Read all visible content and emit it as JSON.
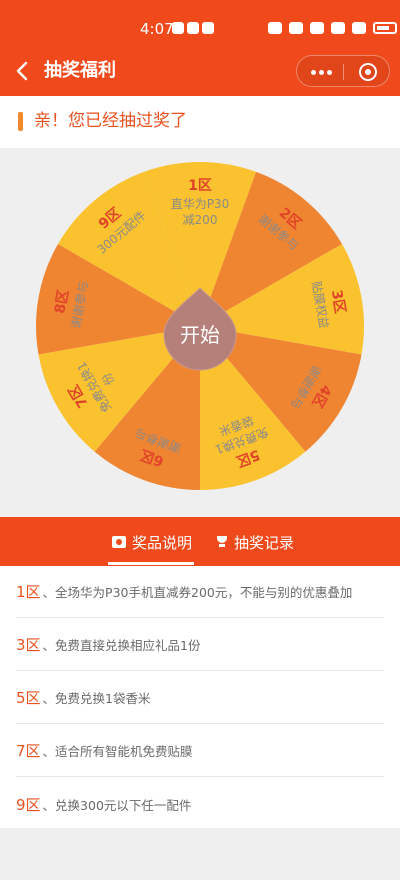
{
  "status_bar": {
    "time": "4:07"
  },
  "nav": {
    "title": "抽奖福利"
  },
  "notice": {
    "text": "亲！您已经抽过奖了"
  },
  "wheel": {
    "start_label": "开始",
    "colors": {
      "yellow": "#f9c22e",
      "orange": "#ef8431",
      "hub": "#b57f7a",
      "zone_text": "#e2442a",
      "prize_text": "#8a8a8a"
    },
    "segments": [
      {
        "zone": "1区",
        "lines": [
          "直华为P30",
          "减200"
        ],
        "color": "yellow"
      },
      {
        "zone": "2区",
        "lines": [
          "谢谢参与"
        ],
        "color": "orange"
      },
      {
        "zone": "3区",
        "lines": [
          "贴膜权益"
        ],
        "color": "yellow"
      },
      {
        "zone": "4区",
        "lines": [
          "谢谢参与"
        ],
        "color": "orange"
      },
      {
        "zone": "5区",
        "lines": [
          "免费兑换1",
          "袋香米"
        ],
        "color": "yellow"
      },
      {
        "zone": "6区",
        "lines": [
          "谢谢参与"
        ],
        "color": "orange"
      },
      {
        "zone": "7区",
        "lines": [
          "免费兑换1",
          "份"
        ],
        "color": "yellow"
      },
      {
        "zone": "8区",
        "lines": [
          "谢谢参与"
        ],
        "color": "orange"
      },
      {
        "zone": "9区",
        "lines": [
          "300元配件"
        ],
        "color": "yellow"
      }
    ]
  },
  "tabs": {
    "prize_info": "奖品说明",
    "records": "抽奖记录"
  },
  "prizes": [
    {
      "zone": "1区",
      "desc": "、全场华为P30手机直减券200元，不能与别的优惠叠加"
    },
    {
      "zone": "3区",
      "desc": "、免费直接兑换相应礼品1份"
    },
    {
      "zone": "5区",
      "desc": "、免费兑换1袋香米"
    },
    {
      "zone": "7区",
      "desc": "、适合所有智能机免费贴膜"
    },
    {
      "zone": "9区",
      "desc": "、兑换300元以下任一配件"
    }
  ]
}
